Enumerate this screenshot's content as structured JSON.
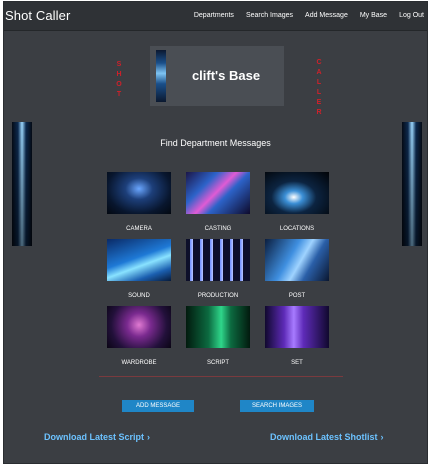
{
  "app": {
    "title": "Shot Caller",
    "nav": [
      "Departments",
      "Search Images",
      "Add Message",
      "My Base",
      "Log Out"
    ]
  },
  "base": {
    "title": "clift's Base",
    "left_vertical": [
      "S",
      "H",
      "O",
      "T"
    ],
    "right_vertical": [
      "C",
      "A",
      "L",
      "L",
      "E",
      "R"
    ]
  },
  "section": {
    "title": "Find Department Messages"
  },
  "departments": [
    {
      "label": "CAMERA",
      "image": "camera-image"
    },
    {
      "label": "CASTING",
      "image": "casting-image"
    },
    {
      "label": "LOCATIONS",
      "image": "locations-image"
    },
    {
      "label": "SOUND",
      "image": "sound-image"
    },
    {
      "label": "PRODUCTION",
      "image": "production-image"
    },
    {
      "label": "POST",
      "image": "post-image"
    },
    {
      "label": "WARDROBE",
      "image": "wardrobe-image"
    },
    {
      "label": "SCRIPT",
      "image": "script-image"
    },
    {
      "label": "SET",
      "image": "set-image"
    }
  ],
  "actions": {
    "add_message": "ADD MESSAGE",
    "search_images": "SEARCH IMAGES"
  },
  "links": {
    "download_script": "Download Latest Script",
    "download_shotlist": "Download Latest Shotlist",
    "chevron": "›"
  },
  "colors": {
    "background": "#3b3e43",
    "accent_red": "#d0202a",
    "button_blue": "#1f86c7",
    "link_blue": "#6cc2ff"
  }
}
